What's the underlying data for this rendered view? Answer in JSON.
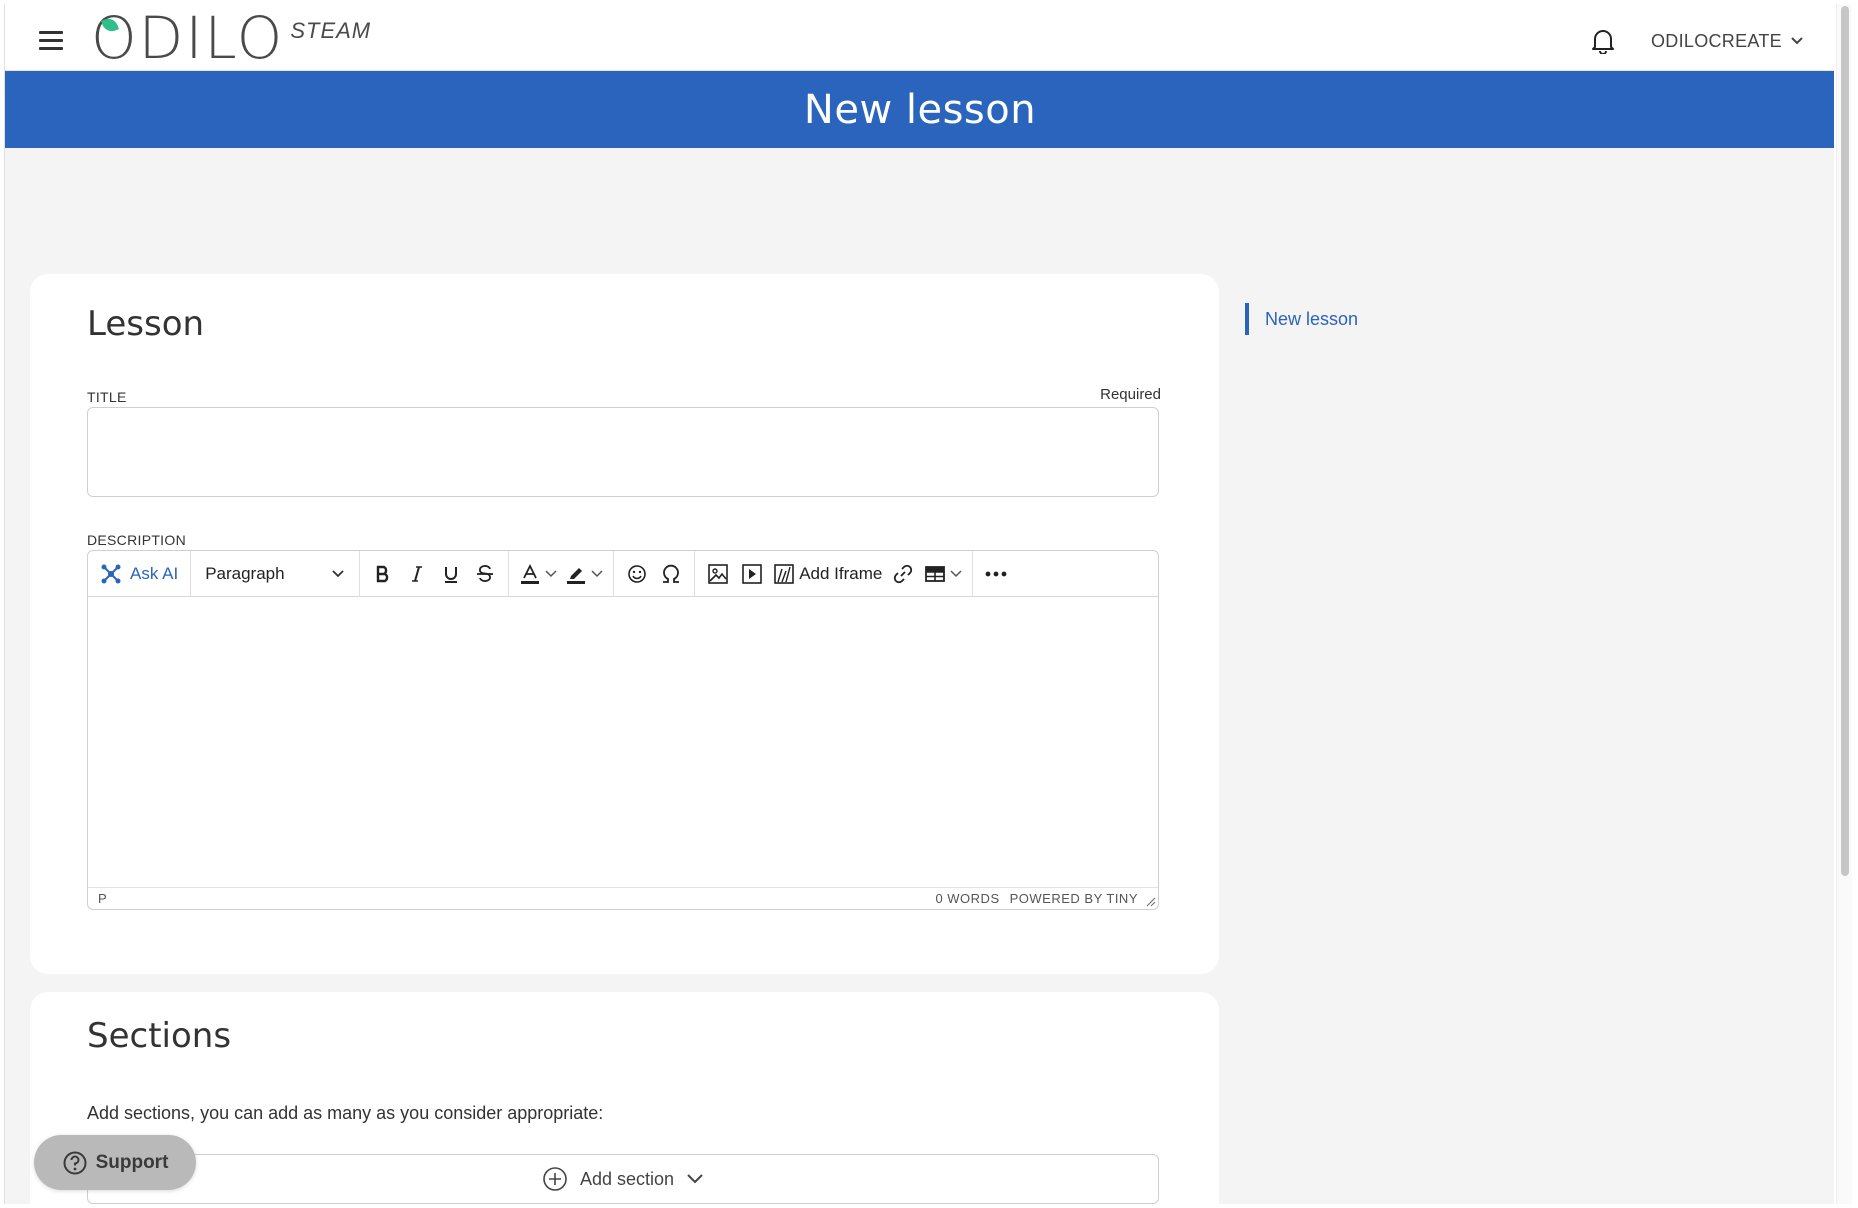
{
  "header": {
    "logo_text": "ODILO",
    "logo_sub": "STEAM",
    "user_label": "ODILOCREATE"
  },
  "page": {
    "title": "New lesson"
  },
  "anchor_nav": {
    "items": [
      {
        "label": "New lesson"
      }
    ]
  },
  "lesson_card": {
    "heading": "Lesson",
    "title_label": "TITLE",
    "title_required": "Required",
    "title_value": "",
    "description_label": "DESCRIPTION",
    "editor": {
      "ask_ai_label": "Ask AI",
      "block_format": "Paragraph",
      "add_iframe_label": "Add Iframe",
      "status_path": "P",
      "word_count": "0 WORDS",
      "powered_by": "POWERED BY TINY"
    }
  },
  "sections_card": {
    "heading": "Sections",
    "help_text": "Add sections, you can add as many as you consider appropriate:",
    "add_section_label": "Add section"
  },
  "support": {
    "label": "Support"
  },
  "colors": {
    "brand_blue": "#2a64bc",
    "logo_leaf": "#2fc08a"
  }
}
